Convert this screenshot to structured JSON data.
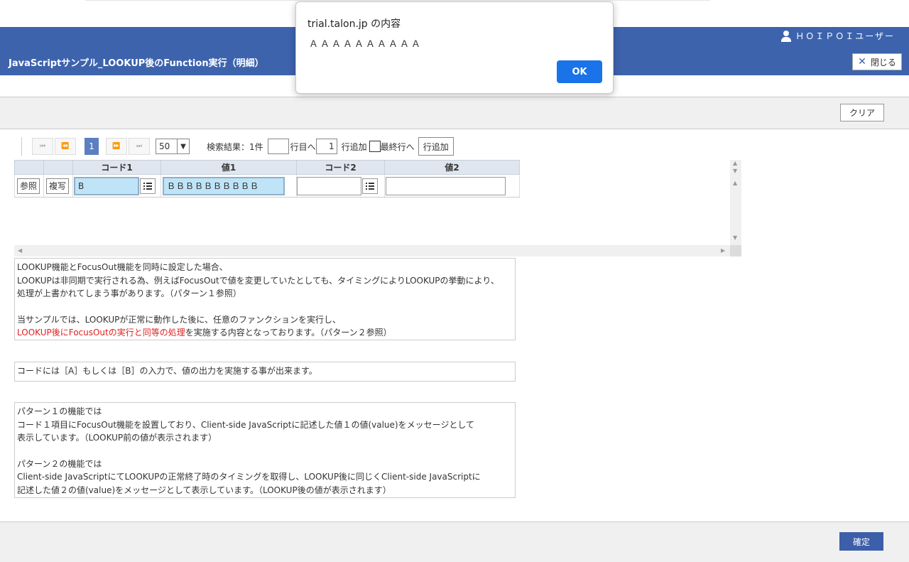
{
  "header": {
    "user_name": "ＨＯＩＰＯＩユーザー",
    "title": "JavaScriptサンプル_LOOKUP後のFunction実行（明細）",
    "close_label": "閉じる"
  },
  "toolbar": {
    "clear_label": "クリア"
  },
  "pager": {
    "first_icon": "⏮",
    "prev_icon": "⏪",
    "current_page": "1",
    "next_icon": "⏩",
    "last_icon": "⏭",
    "page_size": "50",
    "result_text": "検索結果：1件",
    "goto_value": "",
    "goto_suffix": "行目へ",
    "add_count": "1",
    "add_suffix": "行追加",
    "last_row_label": "最終行へ",
    "add_button_label": "行追加"
  },
  "grid": {
    "headers": {
      "code1": "コード1",
      "value1": "値1",
      "code2": "コード2",
      "value2": "値2"
    },
    "row": {
      "ref_label": "参照",
      "copy_label": "複写",
      "code1": "B",
      "value1": "ＢＢＢＢＢＢＢＢＢＢ",
      "code2": "",
      "value2": ""
    }
  },
  "notes": {
    "n1_l1": "LOOKUP機能とFocusOut機能を同時に設定した場合、",
    "n1_l2": "LOOKUPは非同期で実行される為、例えばFocusOutで値を変更していたとしても、タイミングによりLOOKUPの挙動により、",
    "n1_l3": "処理が上書かれてしまう事があります。（パターン１参照）",
    "n1_l4": "当サンプルでは、LOOKUPが正常に動作した後に、任意のファンクションを実行し、",
    "n1_l5_red": "LOOKUP後にFocusOutの実行と同等の処理",
    "n1_l5_rest": "を実施する内容となっております。（パターン２参照）",
    "n2": "コードには［A］もしくは［B］の入力で、値の出力を実施する事が出来ます。",
    "n3_l1": "パターン１の機能では",
    "n3_l2": "コード１項目にFocusOut機能を設置しており、Client-side JavaScriptに記述した値１の値(value)をメッセージとして",
    "n3_l3": "表示しています。（LOOKUP前の値が表示されます）",
    "n3_l4": "パターン２の機能では",
    "n3_l5": "Client-side JavaScriptにてLOOKUPの正常終了時のタイミングを取得し、LOOKUP後に同じくClient-side JavaScriptに",
    "n3_l6": "記述した値２の値(value)をメッセージとして表示しています。（LOOKUP後の値が表示されます）"
  },
  "footer": {
    "confirm_label": "確定"
  },
  "dialog": {
    "title": "trial.talon.jp の内容",
    "message": "ＡＡＡＡＡＡＡＡＡＡ",
    "ok_label": "OK"
  },
  "colors": {
    "header_bg": "#3d63ad",
    "highlight_field": "#bfe4f7",
    "ok_button": "#1a73e8",
    "red_text": "#e02020"
  }
}
